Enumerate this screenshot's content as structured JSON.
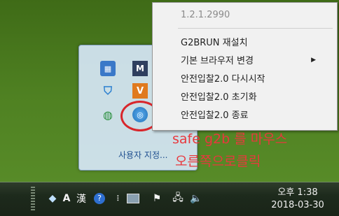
{
  "context_menu": {
    "version": "1.2.1.2990",
    "items": [
      {
        "label": "G2BRUN 재설치"
      },
      {
        "label": "기본 브라우저 변경"
      },
      {
        "label": "안전입찰2.0 다시시작"
      },
      {
        "label": "안전입찰2.0 초기화"
      },
      {
        "label": "안전입찰2.0 종료"
      }
    ]
  },
  "tray_popup": {
    "customize_label": "사용자 지정..."
  },
  "annotation": {
    "line1": "safe g2b 를 마우스",
    "line2": "오른쪽으로클릭"
  },
  "taskbar": {
    "ime_label": "A",
    "hanja_label": "漢",
    "clock_time": "오후 1:38",
    "clock_date": "2018-03-30"
  },
  "colors": {
    "annotation": "#e8383d",
    "highlight_circle": "#d8262b"
  }
}
